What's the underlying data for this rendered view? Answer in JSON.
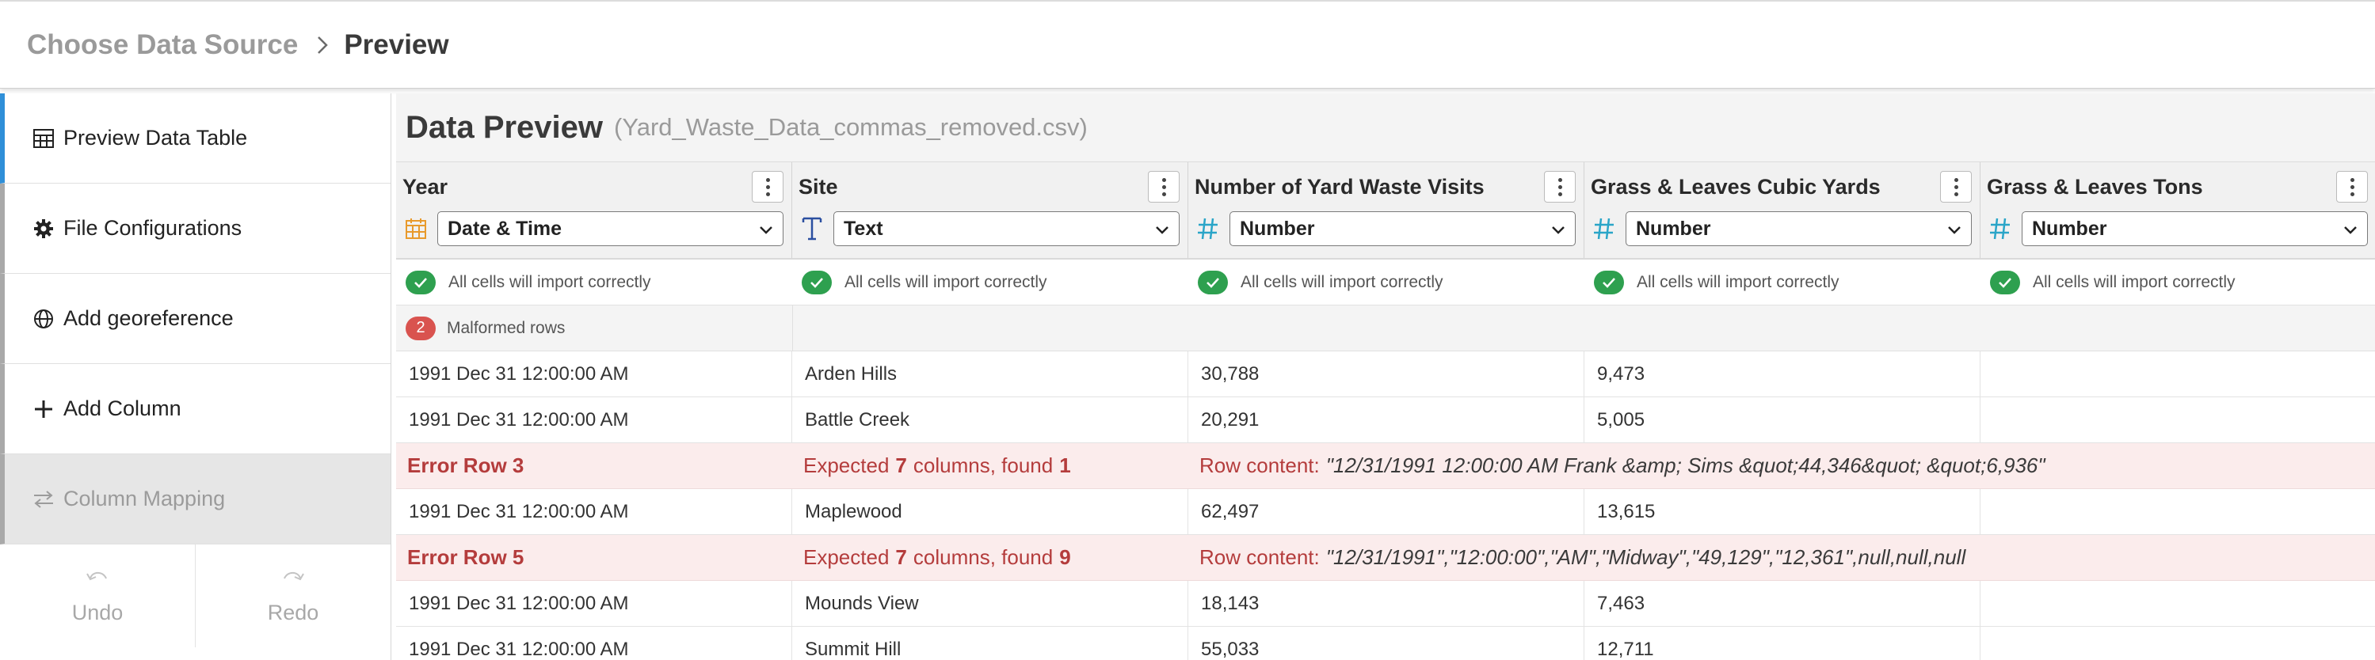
{
  "breadcrumb": {
    "parent": "Choose Data Source",
    "current": "Preview"
  },
  "sidebar": {
    "items": [
      {
        "label": "Preview Data Table",
        "icon": "table-icon",
        "state": "active"
      },
      {
        "label": "File Configurations",
        "icon": "gear-icon",
        "state": "normal"
      },
      {
        "label": "Add georeference",
        "icon": "globe-icon",
        "state": "normal"
      },
      {
        "label": "Add Column",
        "icon": "plus-icon",
        "state": "normal"
      },
      {
        "label": "Column Mapping",
        "icon": "swap-arrows-icon",
        "state": "disabled"
      }
    ],
    "undo_label": "Undo",
    "redo_label": "Redo"
  },
  "preview": {
    "title": "Data Preview",
    "filename": "(Yard_Waste_Data_commas_removed.csv)"
  },
  "columns": [
    {
      "title": "Year",
      "type": "Date & Time",
      "type_icon": "calendar-icon",
      "status": "All cells will import correctly"
    },
    {
      "title": "Site",
      "type": "Text",
      "type_icon": "text-type-icon",
      "status": "All cells will import correctly"
    },
    {
      "title": "Number of Yard Waste Visits",
      "type": "Number",
      "type_icon": "hash-icon",
      "status": "All cells will import correctly"
    },
    {
      "title": "Grass & Leaves Cubic Yards",
      "type": "Number",
      "type_icon": "hash-icon",
      "status": "All cells will import correctly"
    },
    {
      "title": "Grass & Leaves Tons",
      "type": "Number",
      "type_icon": "hash-icon",
      "status": "All cells will import correctly"
    }
  ],
  "malformed": {
    "count": "2",
    "label": "Malformed rows"
  },
  "rows": [
    {
      "kind": "data",
      "cells": [
        "1991 Dec 31 12:00:00 AM",
        "Arden Hills",
        "30,788",
        "9,473",
        ""
      ]
    },
    {
      "kind": "data",
      "cells": [
        "1991 Dec 31 12:00:00 AM",
        "Battle Creek",
        "20,291",
        "5,005",
        ""
      ]
    },
    {
      "kind": "error",
      "label": "Error Row 3",
      "expected_prefix": "Expected",
      "expected": "7",
      "found_prefix": "columns, found",
      "found": "1",
      "content_label": "Row content:",
      "content": "\"12/31/1991 12:00:00 AM Frank &amp; Sims &quot;44,346&quot; &quot;6,936\""
    },
    {
      "kind": "data",
      "cells": [
        "1991 Dec 31 12:00:00 AM",
        "Maplewood",
        "62,497",
        "13,615",
        ""
      ]
    },
    {
      "kind": "error",
      "label": "Error Row 5",
      "expected_prefix": "Expected",
      "expected": "7",
      "found_prefix": "columns, found",
      "found": "9",
      "content_label": "Row content:",
      "content": "\"12/31/1991\",\"12:00:00\",\"AM\",\"Midway\",\"49,129\",\"12,361\",null,null,null"
    },
    {
      "kind": "data",
      "cells": [
        "1991 Dec 31 12:00:00 AM",
        "Mounds View",
        "18,143",
        "7,463",
        ""
      ]
    },
    {
      "kind": "data",
      "cells": [
        "1991 Dec 31 12:00:00 AM",
        "Summit Hill",
        "55,033",
        "12,711",
        ""
      ]
    }
  ],
  "colors": {
    "accent": "#2f8fd8",
    "success": "#2ea04f",
    "error": "#b43c3c",
    "error_bg": "#fbecec",
    "badge": "#d9534f",
    "date_icon": "#e89a2c",
    "text_icon": "#2b4fa0",
    "number_icon": "#2aa5c8"
  }
}
